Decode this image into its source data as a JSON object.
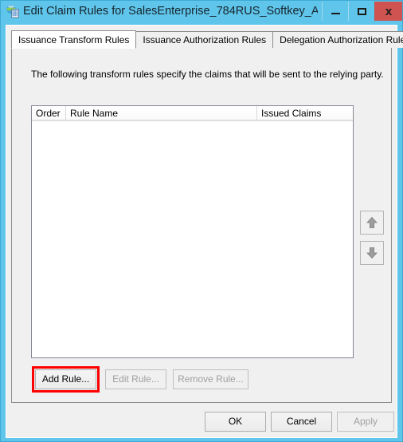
{
  "window": {
    "title": "Edit Claim Rules for SalesEnterprise_784RUS_Softkey_A...",
    "icon": "adfs-relying-party-icon",
    "controls": {
      "minimize": "–",
      "maximize": "□",
      "close": "x"
    },
    "border_color": "#5fc5ea",
    "close_color": "#cf5350"
  },
  "tabs": [
    {
      "label": "Issuance Transform Rules",
      "active": true
    },
    {
      "label": "Issuance Authorization Rules",
      "active": false
    },
    {
      "label": "Delegation Authorization Rules",
      "active": false
    }
  ],
  "main": {
    "description": "The following transform rules specify the claims that will be sent to the relying party.",
    "list": {
      "columns": [
        "Order",
        "Rule Name",
        "Issued Claims"
      ],
      "rows": []
    },
    "reorder": {
      "move_up": "move-up-arrow",
      "move_down": "move-down-arrow"
    },
    "actions": [
      {
        "label": "Add Rule...",
        "enabled": true,
        "highlighted": true
      },
      {
        "label": "Edit Rule...",
        "enabled": false,
        "highlighted": false
      },
      {
        "label": "Remove Rule...",
        "enabled": false,
        "highlighted": false
      }
    ]
  },
  "footer": {
    "ok": "OK",
    "cancel": "Cancel",
    "apply": "Apply"
  },
  "highlight": {
    "color": "#ff0000"
  }
}
